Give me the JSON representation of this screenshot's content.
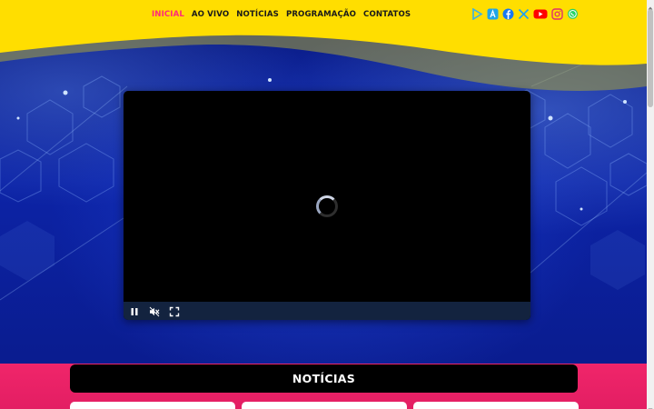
{
  "nav": {
    "items": [
      {
        "label": "INICIAL",
        "active": true
      },
      {
        "label": "AO VIVO",
        "active": false
      },
      {
        "label": "NOTÍCIAS",
        "active": false
      },
      {
        "label": "PROGRAMAÇÃO",
        "active": false
      },
      {
        "label": "CONTATOS",
        "active": false
      }
    ]
  },
  "social": [
    {
      "icon": "google-play-icon",
      "color": "#3ab0e6"
    },
    {
      "icon": "app-store-icon",
      "color": "#1fa4e8"
    },
    {
      "icon": "facebook-icon",
      "color": "#1877f2"
    },
    {
      "icon": "x-twitter-icon",
      "color": "#1da1f2"
    },
    {
      "icon": "youtube-icon",
      "color": "#ff0000"
    },
    {
      "icon": "instagram-icon",
      "color": "#e1306c"
    },
    {
      "icon": "whatsapp-icon",
      "color": "#25d366"
    }
  ],
  "player": {
    "state": "loading",
    "controls": [
      "pause-icon",
      "mute-icon",
      "fullscreen-icon"
    ]
  },
  "news": {
    "title": "NOTÍCIAS"
  },
  "colors": {
    "topbar": "#ffde00",
    "accent": "#ff2a7a",
    "pink_section": "#e31e63",
    "hero_blue": "#0c23a6"
  }
}
